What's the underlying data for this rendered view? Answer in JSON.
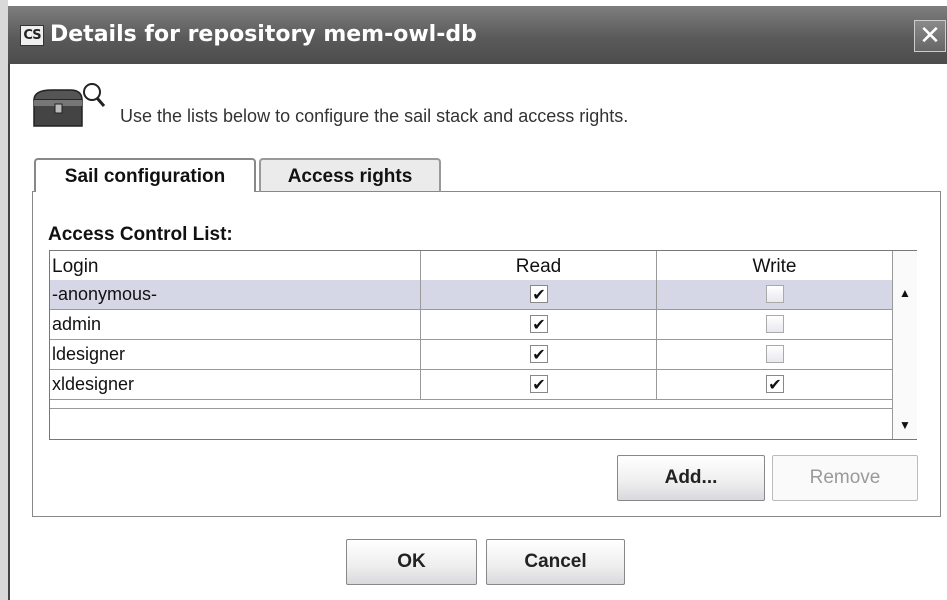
{
  "window": {
    "title": "Details for repository mem-owl-db",
    "app_icon_text": "CS",
    "close_symbol": "✕"
  },
  "instruction": "Use the lists below to configure the sail stack and access rights.",
  "tabs": [
    {
      "label": "Sail configuration",
      "selected": true
    },
    {
      "label": "Access rights",
      "selected": false
    }
  ],
  "acl": {
    "label": "Access Control List:",
    "columns": [
      "Login",
      "Read",
      "Write"
    ],
    "rows": [
      {
        "login": "-anonymous-",
        "read": true,
        "write": false,
        "selected": true
      },
      {
        "login": "admin",
        "read": true,
        "write": false,
        "selected": false
      },
      {
        "login": "ldesigner",
        "read": true,
        "write": false,
        "selected": false
      },
      {
        "login": "xldesigner",
        "read": true,
        "write": true,
        "selected": false
      }
    ],
    "check_mark": "✔"
  },
  "buttons": {
    "add": "Add...",
    "remove": "Remove",
    "ok": "OK",
    "cancel": "Cancel"
  },
  "icons": {
    "app": "cs-app-icon",
    "repository": "treasure-chest-magnifier-icon",
    "scroll_up": "arrow-up-icon",
    "scroll_down": "arrow-down-icon"
  },
  "colors": {
    "titlebar": "#5a5a5a",
    "selected_row": "#d6d7e6"
  }
}
